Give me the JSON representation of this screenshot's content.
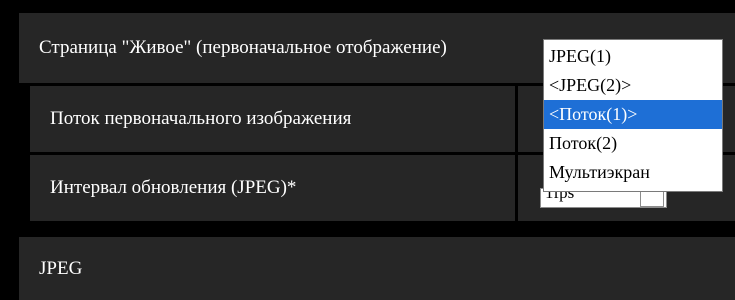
{
  "live_page": {
    "header_title": "Страница \"Живое\" (первоначальное отображение)",
    "rows": [
      {
        "label": "Поток первоначального изображения"
      },
      {
        "label": "Интервал обновления (JPEG)*"
      }
    ],
    "refresh_interval_select": {
      "value": "1fps"
    }
  },
  "stream_dropdown": {
    "options": [
      "JPEG(1)",
      "<JPEG(2)>",
      "<Поток(1)>",
      "Поток(2)",
      "Мультиэкран"
    ],
    "selected_index": 2
  },
  "jpeg_section": {
    "title": "JPEG"
  },
  "colors": {
    "background": "#000000",
    "panel": "#262626",
    "selected_option": "#1e6fd6"
  }
}
